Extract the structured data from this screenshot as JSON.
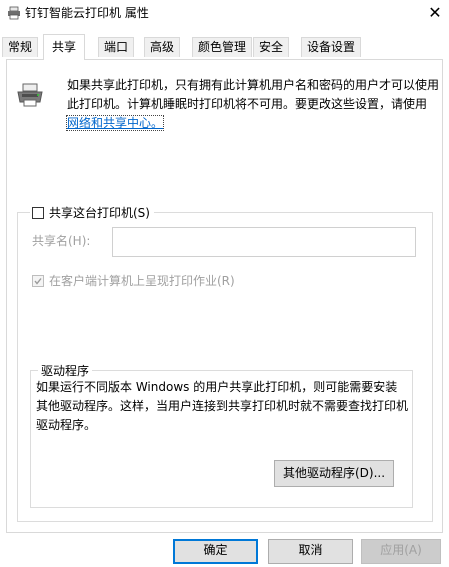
{
  "window": {
    "title": "钉钉智能云打印机 属性",
    "close_glyph": "✕"
  },
  "tabs": [
    {
      "label": "常规"
    },
    {
      "label": "共享",
      "active": true
    },
    {
      "label": "端口"
    },
    {
      "label": "高级"
    },
    {
      "label": "颜色管理"
    },
    {
      "label": "安全"
    },
    {
      "label": "设备设置"
    }
  ],
  "share_tab": {
    "info_text_before": "如果共享此打印机，只有拥有此计算机用户名和密码的用户才可以使用此打印机。计算机睡眠时打印机将不可用。要更改这些设置，请使用",
    "info_link": "网络和共享中心。",
    "share_checkbox_label": "共享这台打印机(S)",
    "share_checked": false,
    "share_name_label": "共享名(H):",
    "share_name_value": "",
    "render_checkbox_label": "在客户端计算机上呈现打印作业(R)",
    "render_checked": true,
    "render_disabled": true,
    "drivers": {
      "title": "驱动程序",
      "text": "如果运行不同版本 Windows 的用户共享此打印机，则可能需要安装其他驱动程序。这样，当用户连接到共享打印机时就不需要查找打印机驱动程序。",
      "button_label": "其他驱动程序(D)..."
    }
  },
  "footer": {
    "ok_label": "确定",
    "cancel_label": "取消",
    "apply_label": "应用(A)"
  },
  "icons": {
    "title_icon": "printer-icon",
    "tab_icon": "printer-icon",
    "close": "close-icon"
  },
  "colors": {
    "link": "#0066cc",
    "primary_border": "#0078d7",
    "disabled_text": "#a0a0a0"
  }
}
